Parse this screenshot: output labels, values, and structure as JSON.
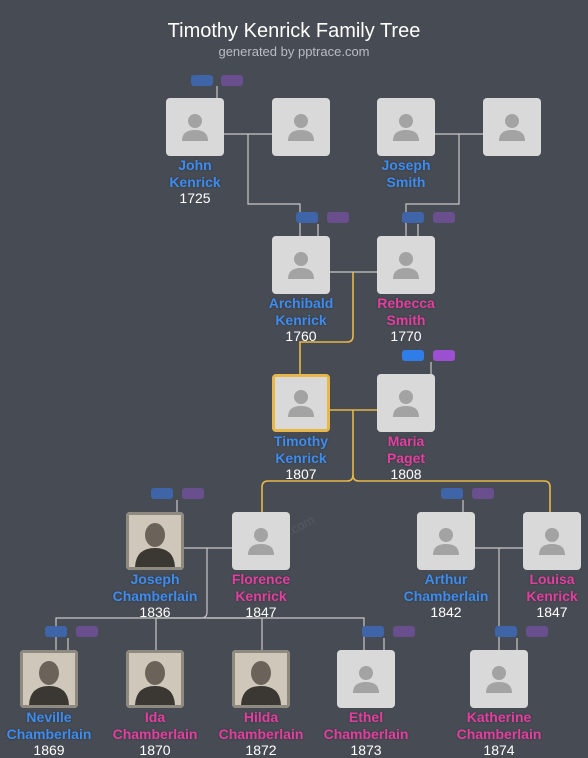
{
  "title": "Timothy Kenrick Family Tree",
  "subtitle": "generated by pptrace.com",
  "watermark": "pptrace.com",
  "colors": {
    "male": "#3d8cf0",
    "female": "#e43fa0",
    "line": "#c8c8c8",
    "highlight": "#e7b848"
  },
  "people": {
    "john": {
      "first": "John",
      "last": "Kenrick",
      "year": "1725",
      "sex": "male",
      "photo": "placeholder"
    },
    "johnWife": {
      "first": "",
      "last": "",
      "year": "",
      "sex": "female",
      "photo": "placeholder"
    },
    "joseph": {
      "first": "Joseph",
      "last": "Smith",
      "year": "",
      "sex": "male",
      "photo": "placeholder"
    },
    "josephWife": {
      "first": "",
      "last": "",
      "year": "",
      "sex": "female",
      "photo": "placeholder"
    },
    "archibald": {
      "first": "Archibald",
      "last": "Kenrick",
      "year": "1760",
      "sex": "male",
      "photo": "placeholder"
    },
    "rebecca": {
      "first": "Rebecca",
      "last": "Smith",
      "year": "1770",
      "sex": "female",
      "photo": "placeholder"
    },
    "timothy": {
      "first": "Timothy",
      "last": "Kenrick",
      "year": "1807",
      "sex": "male",
      "photo": "placeholder",
      "selected": true
    },
    "maria": {
      "first": "Maria",
      "last": "Paget",
      "year": "1808",
      "sex": "female",
      "photo": "placeholder"
    },
    "josephC": {
      "first": "Joseph",
      "last": "Chamberlain",
      "year": "1836",
      "sex": "male",
      "photo": "portrait"
    },
    "florence": {
      "first": "Florence",
      "last": "Kenrick",
      "year": "1847",
      "sex": "female",
      "photo": "placeholder"
    },
    "arthur": {
      "first": "Arthur",
      "last": "Chamberlain",
      "year": "1842",
      "sex": "male",
      "photo": "placeholder"
    },
    "louisa": {
      "first": "Louisa",
      "last": "Kenrick",
      "year": "1847",
      "sex": "female",
      "photo": "placeholder"
    },
    "neville": {
      "first": "Neville",
      "last": "Chamberlain",
      "year": "1869",
      "sex": "male",
      "photo": "portrait"
    },
    "ida": {
      "first": "Ida",
      "last": "Chamberlain",
      "year": "1870",
      "sex": "female",
      "photo": "portrait"
    },
    "hilda": {
      "first": "Hilda",
      "last": "Chamberlain",
      "year": "1872",
      "sex": "female",
      "photo": "portrait"
    },
    "ethel": {
      "first": "Ethel",
      "last": "Chamberlain",
      "year": "1873",
      "sex": "female",
      "photo": "placeholder"
    },
    "katherine": {
      "first": "Katherine",
      "last": "Chamberlain",
      "year": "1874",
      "sex": "female",
      "photo": "placeholder"
    }
  }
}
